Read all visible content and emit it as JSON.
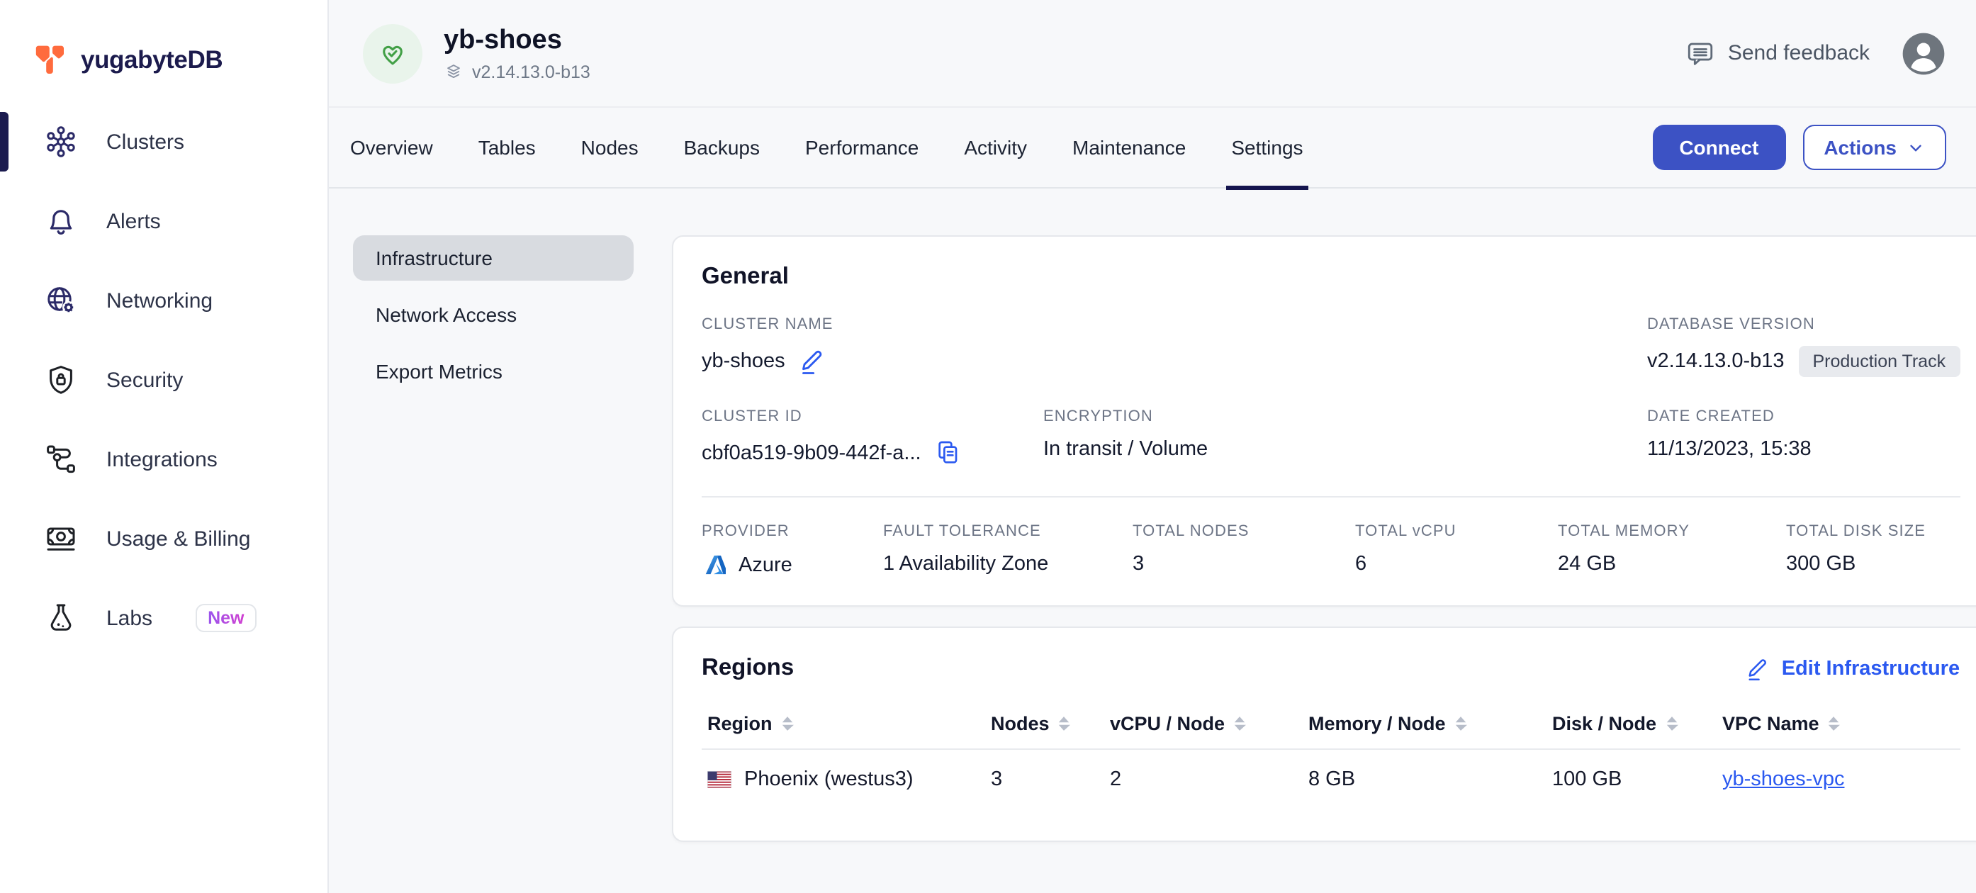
{
  "brand": {
    "name": "yugabyteDB"
  },
  "sidebar": {
    "items": [
      {
        "label": "Clusters",
        "active": true
      },
      {
        "label": "Alerts"
      },
      {
        "label": "Networking"
      },
      {
        "label": "Security"
      },
      {
        "label": "Integrations"
      },
      {
        "label": "Usage & Billing"
      },
      {
        "label": "Labs",
        "badge": "New"
      }
    ]
  },
  "header": {
    "title": "yb-shoes",
    "version": "v2.14.13.0-b13",
    "feedback_label": "Send feedback"
  },
  "tabs": {
    "active": "Settings",
    "items": [
      {
        "label": "Overview"
      },
      {
        "label": "Tables"
      },
      {
        "label": "Nodes"
      },
      {
        "label": "Backups"
      },
      {
        "label": "Performance"
      },
      {
        "label": "Activity"
      },
      {
        "label": "Maintenance"
      },
      {
        "label": "Settings"
      }
    ]
  },
  "toolbar": {
    "connect_label": "Connect",
    "actions_label": "Actions"
  },
  "subnav": {
    "active": "Infrastructure",
    "items": [
      {
        "label": "Infrastructure"
      },
      {
        "label": "Network Access"
      },
      {
        "label": "Export Metrics"
      }
    ]
  },
  "general": {
    "title": "General",
    "cluster_name": {
      "label": "Cluster Name",
      "value": "yb-shoes"
    },
    "database_version": {
      "label": "Database Version",
      "value": "v2.14.13.0-b13",
      "badge": "Production Track"
    },
    "cluster_id": {
      "label": "Cluster ID",
      "value": "cbf0a519-9b09-442f-a..."
    },
    "encryption": {
      "label": "Encryption",
      "value": "In transit / Volume"
    },
    "date_created": {
      "label": "Date Created",
      "value": "11/13/2023, 15:38"
    },
    "provider": {
      "label": "Provider",
      "value": "Azure"
    },
    "fault_tolerance": {
      "label": "Fault Tolerance",
      "value": "1 Availability Zone"
    },
    "total_nodes": {
      "label": "Total Nodes",
      "value": "3"
    },
    "total_vcpu": {
      "label": "Total vCPU",
      "value": "6"
    },
    "total_memory": {
      "label": "Total Memory",
      "value": "24 GB"
    },
    "total_disk": {
      "label": "Total Disk Size",
      "value": "300 GB"
    }
  },
  "regions": {
    "title": "Regions",
    "edit_label": "Edit Infrastructure",
    "table": {
      "headers": [
        {
          "label": "Region"
        },
        {
          "label": "Nodes"
        },
        {
          "label": "vCPU / Node"
        },
        {
          "label": "Memory / Node"
        },
        {
          "label": "Disk / Node"
        },
        {
          "label": "VPC Name"
        }
      ],
      "rows": [
        {
          "region": "Phoenix (westus3)",
          "flag": "us-flag",
          "nodes": "3",
          "vcpu": "2",
          "memory": "8 GB",
          "disk": "100 GB",
          "vpc": "yb-shoes-vpc"
        }
      ]
    }
  },
  "colors": {
    "accent_blue": "#3C52C4",
    "link_blue": "#2B59F0",
    "success_green": "#43A047",
    "brand_orange": "#FF6B3D",
    "navy": "#15154E",
    "badge_new_gradient": [
      "#8B5CF6",
      "#E039C8"
    ]
  }
}
